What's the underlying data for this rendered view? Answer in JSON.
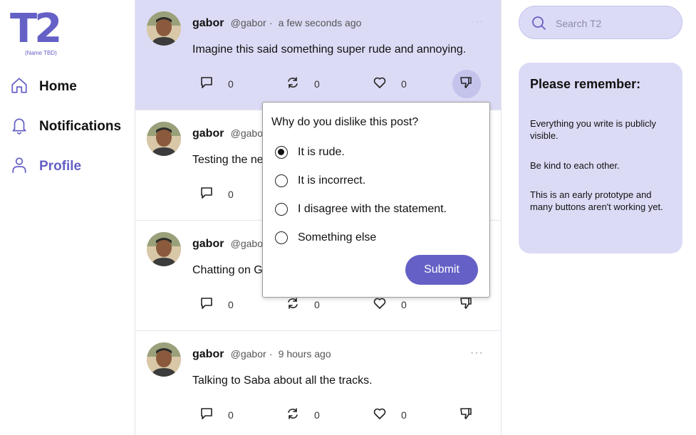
{
  "brand": {
    "logo_text": "T2",
    "logo_sub": "(Name TBD)",
    "accent_color": "#6560c6",
    "highlight_color": "#dcdbf6"
  },
  "nav": [
    {
      "label": "Home",
      "icon": "home-icon"
    },
    {
      "label": "Notifications",
      "icon": "bell-icon"
    },
    {
      "label": "Profile",
      "icon": "user-icon",
      "active": true
    }
  ],
  "posts": [
    {
      "author": "gabor",
      "handle": "@gabor",
      "dot": "·",
      "time": "a few seconds ago",
      "body": "Imagine this said something super rude and annoying.",
      "replies": "0",
      "reposts": "0",
      "likes": "0",
      "more": "···"
    },
    {
      "author": "gabor",
      "handle": "@gabo",
      "body": "Testing the ne",
      "replies": "0"
    },
    {
      "author": "gabor",
      "handle": "@gabo",
      "body": "Chatting on G",
      "replies": "0",
      "reposts": "0",
      "likes": "0"
    },
    {
      "author": "gabor",
      "handle": "@gabor",
      "dot": "·",
      "time": "9 hours ago",
      "body": "Talking to Saba about all the tracks.",
      "replies": "0",
      "reposts": "0",
      "likes": "0",
      "more": "···"
    }
  ],
  "dislike_popover": {
    "title": "Why do you dislike this post?",
    "options": [
      "It is rude.",
      "It is incorrect.",
      "I disagree with the statement.",
      "Something else"
    ],
    "selected": "It is rude.",
    "submit_label": "Submit"
  },
  "search": {
    "placeholder": "Search T2"
  },
  "remember": {
    "title": "Please remember:",
    "lines": [
      "Everything you write is publicly visible.",
      "Be kind to each other.",
      "This is an early prototype and many buttons aren't working yet."
    ]
  }
}
